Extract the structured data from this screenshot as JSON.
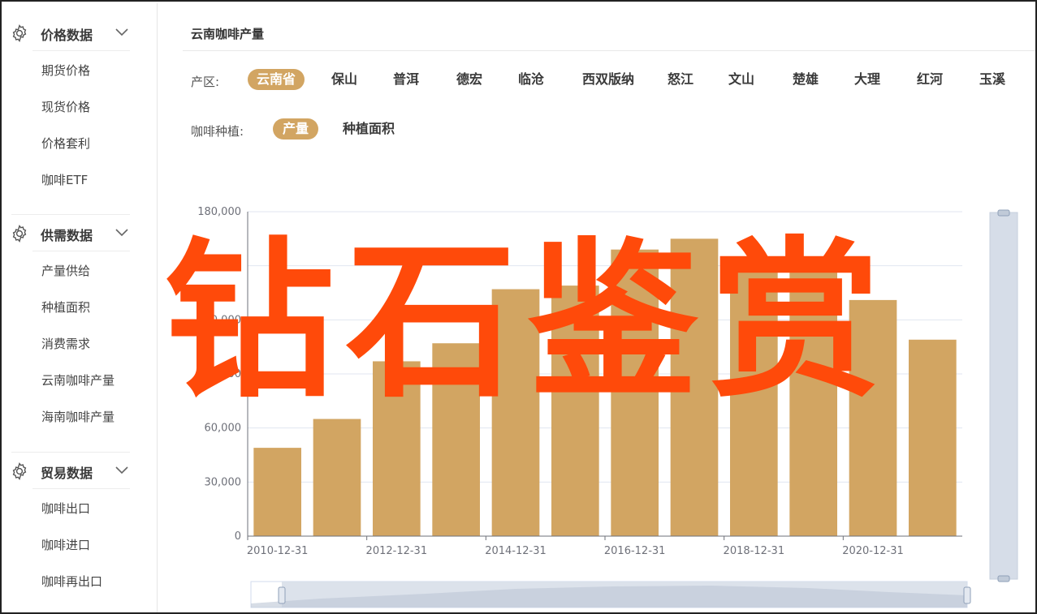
{
  "sidebar": {
    "groups": [
      {
        "title": "价格数据",
        "items": [
          "期货价格",
          "现货价格",
          "价格套利",
          "咖啡ETF"
        ]
      },
      {
        "title": "供需数据",
        "items": [
          "产量供给",
          "种植面积",
          "消费需求",
          "云南咖啡产量",
          "海南咖啡产量"
        ]
      },
      {
        "title": "贸易数据",
        "items": [
          "咖啡出口",
          "咖啡进口",
          "咖啡再出口"
        ]
      }
    ]
  },
  "main": {
    "breadcrumb": "云南咖啡产量",
    "region_label": "产区:",
    "regions": [
      "云南省",
      "保山",
      "普洱",
      "德宏",
      "临沧",
      "西双版纳",
      "怒江",
      "文山",
      "楚雄",
      "大理",
      "红河",
      "玉溪"
    ],
    "active_region": "云南省",
    "metric_label": "咖啡种植:",
    "metrics": [
      "产量",
      "种植面积"
    ],
    "active_metric": "产量"
  },
  "watermark": "钻石鉴赏",
  "chart_data": {
    "type": "bar",
    "title": "",
    "xlabel": "",
    "ylabel": "",
    "x_tick_labels": [
      "2010-12-31",
      "2012-12-31",
      "2014-12-31",
      "2016-12-31",
      "2018-12-31",
      "2020-12-31"
    ],
    "y_tick_labels": [
      "0",
      "30,000",
      "60,000",
      "90,000",
      "120,000",
      "150,000",
      "180,000"
    ],
    "categories": [
      "2010-12-31",
      "2011-12-31",
      "2012-12-31",
      "2013-12-31",
      "2014-12-31",
      "2015-12-31",
      "2016-12-31",
      "2017-12-31",
      "2018-12-31",
      "2019-12-31",
      "2020-12-31",
      "2021-12-31"
    ],
    "values": [
      49000,
      65000,
      97000,
      107000,
      137000,
      139000,
      159000,
      165000,
      151000,
      148000,
      131000,
      109000
    ],
    "ylim": [
      0,
      180000
    ],
    "grid": true,
    "colors": {
      "bar": "#d2a562",
      "axis": "#6e7079",
      "grid": "#e0e6f1",
      "slider": "#d6dde8"
    }
  }
}
